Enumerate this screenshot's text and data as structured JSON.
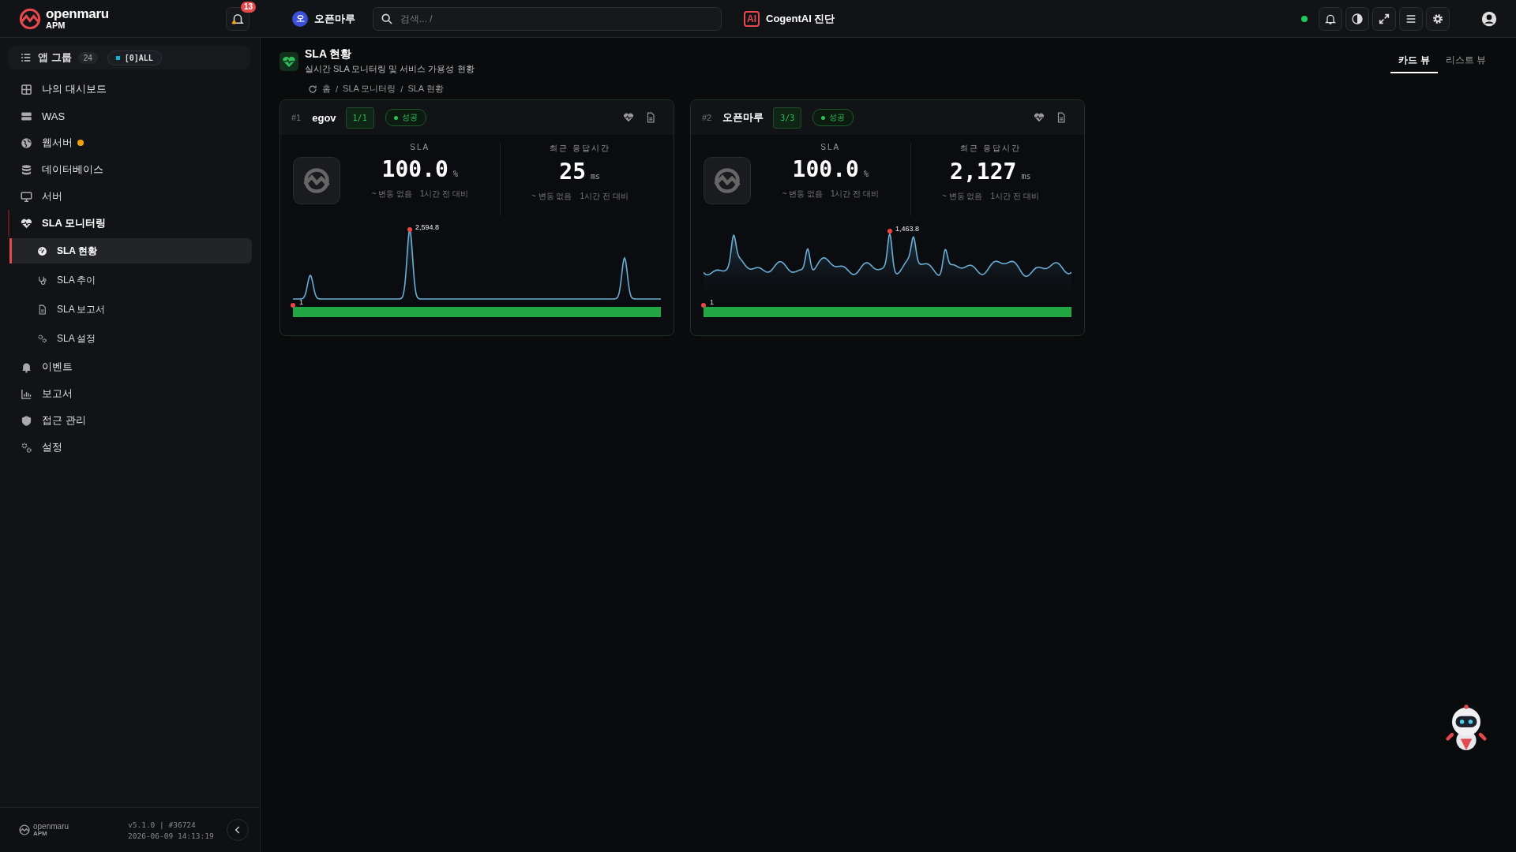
{
  "header": {
    "logo": {
      "name": "openmaru",
      "sub": "APM"
    },
    "notification_count": "13",
    "workspace": {
      "initial": "오",
      "name": "오픈마루"
    },
    "search": {
      "placeholder": "검색... /"
    },
    "ai": {
      "badge": "AI",
      "label": "CogentAI 진단"
    },
    "online": true
  },
  "sidebar": {
    "app_group": {
      "label": "앱 그룹",
      "count": "24",
      "filter": "[0]ALL"
    },
    "items": [
      {
        "kind": "dashboard",
        "label": "나의 대시보드",
        "alert": false,
        "expanded": false
      },
      {
        "kind": "was",
        "label": "WAS",
        "alert": false,
        "expanded": false
      },
      {
        "kind": "webserver",
        "label": "웹서버",
        "alert": true,
        "expanded": false
      },
      {
        "kind": "database",
        "label": "데이터베이스",
        "alert": false,
        "expanded": false
      },
      {
        "kind": "server",
        "label": "서버",
        "alert": false,
        "expanded": false
      },
      {
        "kind": "sla",
        "label": "SLA 모니터링",
        "alert": false,
        "expanded": true,
        "children": [
          {
            "kind": "gauge",
            "label": "SLA 현황",
            "selected": true
          },
          {
            "kind": "stethoscope",
            "label": "SLA 추이",
            "selected": false
          },
          {
            "kind": "document",
            "label": "SLA 보고서",
            "selected": false
          },
          {
            "kind": "gears",
            "label": "SLA 설정",
            "selected": false
          }
        ]
      },
      {
        "kind": "event",
        "label": "이벤트",
        "alert": false,
        "expanded": false
      },
      {
        "kind": "report",
        "label": "보고서",
        "alert": false,
        "expanded": false
      },
      {
        "kind": "access",
        "label": "접근 관리",
        "alert": false,
        "expanded": false
      },
      {
        "kind": "settings",
        "label": "설정",
        "alert": false,
        "expanded": false
      }
    ],
    "footer": {
      "logo": {
        "name": "openmaru",
        "sub": "APM"
      },
      "version": "v5.1.0 | #36724",
      "timestamp": "2026-06-09 14:13:19"
    }
  },
  "page": {
    "title": "SLA 현황",
    "subtitle": "실시간 SLA 모니터링 및 서비스 가용성 현황",
    "breadcrumb": [
      "홈",
      "SLA 모니터링",
      "SLA 현황"
    ],
    "breadcrumb_separator": "/",
    "view_tabs": [
      {
        "label": "카드 뷰",
        "selected": true
      },
      {
        "label": "리스트 뷰",
        "selected": false
      }
    ]
  },
  "cards": [
    {
      "rank": "#1",
      "name": "egov",
      "count": "1/1",
      "status": "성공",
      "stats": [
        {
          "label": "SLA",
          "value": "100.0",
          "unit": "%",
          "change": "~ 변동 없음",
          "compare": "1시간 전 대비"
        },
        {
          "label": "최근 응답시간",
          "value": "25",
          "unit": "ms",
          "change": "~ 변동 없음",
          "compare": "1시간 전 대비"
        }
      ],
      "trend": {
        "kind": "spikes",
        "peak_label": "2,594.8",
        "start_label": "1"
      },
      "availability": {
        "level": 1
      }
    },
    {
      "rank": "#2",
      "name": "오픈마루",
      "count": "3/3",
      "status": "성공",
      "stats": [
        {
          "label": "SLA",
          "value": "100.0",
          "unit": "%",
          "change": "~ 변동 없음",
          "compare": "1시간 전 대비"
        },
        {
          "label": "최근 응답시간",
          "value": "2,127",
          "unit": "ms",
          "change": "~ 변동 없음",
          "compare": "1시간 전 대비"
        }
      ],
      "trend": {
        "kind": "wave",
        "peak_label": "1,463.8",
        "start_label": "1"
      },
      "availability": {
        "level": 1
      }
    }
  ]
}
